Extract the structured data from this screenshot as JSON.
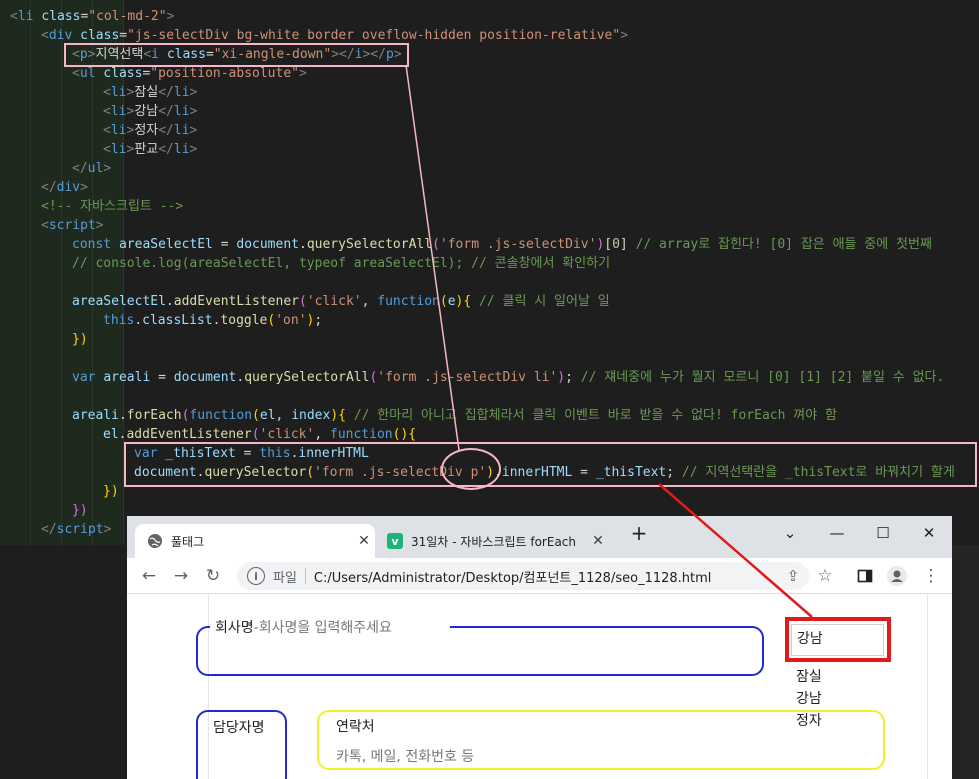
{
  "code": {
    "lines": [
      {
        "indent": 0,
        "tokens": [
          {
            "c": "c-punct",
            "t": "<"
          },
          {
            "c": "c-tag",
            "t": "li"
          },
          {
            "c": "c-plain",
            "t": " "
          },
          {
            "c": "c-attr",
            "t": "class"
          },
          {
            "c": "c-plain",
            "t": "="
          },
          {
            "c": "c-str",
            "t": "\"col-md-2\""
          },
          {
            "c": "c-punct",
            "t": ">"
          }
        ]
      },
      {
        "indent": 1,
        "tokens": [
          {
            "c": "c-punct",
            "t": "<"
          },
          {
            "c": "c-tag",
            "t": "div"
          },
          {
            "c": "c-plain",
            "t": " "
          },
          {
            "c": "c-attr",
            "t": "class"
          },
          {
            "c": "c-plain",
            "t": "="
          },
          {
            "c": "c-str",
            "t": "\"js-selectDiv bg-white border oveflow-hidden position-relative\""
          },
          {
            "c": "c-punct",
            "t": ">"
          }
        ]
      },
      {
        "indent": 2,
        "tokens": [
          {
            "c": "c-punct",
            "t": "<"
          },
          {
            "c": "c-tag",
            "t": "p"
          },
          {
            "c": "c-punct",
            "t": ">"
          },
          {
            "c": "c-text",
            "t": "지역선택"
          },
          {
            "c": "c-punct",
            "t": "<"
          },
          {
            "c": "c-tag",
            "t": "i"
          },
          {
            "c": "c-plain",
            "t": " "
          },
          {
            "c": "c-attr",
            "t": "class"
          },
          {
            "c": "c-plain",
            "t": "="
          },
          {
            "c": "c-str",
            "t": "\"xi-angle-down\""
          },
          {
            "c": "c-punct",
            "t": "></"
          },
          {
            "c": "c-tag",
            "t": "i"
          },
          {
            "c": "c-punct",
            "t": "></"
          },
          {
            "c": "c-tag",
            "t": "p"
          },
          {
            "c": "c-punct",
            "t": ">"
          }
        ]
      },
      {
        "indent": 2,
        "tokens": [
          {
            "c": "c-punct",
            "t": "<"
          },
          {
            "c": "c-tag",
            "t": "ul"
          },
          {
            "c": "c-plain",
            "t": " "
          },
          {
            "c": "c-attr",
            "t": "class"
          },
          {
            "c": "c-plain",
            "t": "="
          },
          {
            "c": "c-str",
            "t": "\"position-absolute\""
          },
          {
            "c": "c-punct",
            "t": ">"
          }
        ]
      },
      {
        "indent": 3,
        "tokens": [
          {
            "c": "c-punct",
            "t": "<"
          },
          {
            "c": "c-tag",
            "t": "li"
          },
          {
            "c": "c-punct",
            "t": ">"
          },
          {
            "c": "c-text",
            "t": "잠실"
          },
          {
            "c": "c-punct",
            "t": "</"
          },
          {
            "c": "c-tag",
            "t": "li"
          },
          {
            "c": "c-punct",
            "t": ">"
          }
        ]
      },
      {
        "indent": 3,
        "tokens": [
          {
            "c": "c-punct",
            "t": "<"
          },
          {
            "c": "c-tag",
            "t": "li"
          },
          {
            "c": "c-punct",
            "t": ">"
          },
          {
            "c": "c-text",
            "t": "강남"
          },
          {
            "c": "c-punct",
            "t": "</"
          },
          {
            "c": "c-tag",
            "t": "li"
          },
          {
            "c": "c-punct",
            "t": ">"
          }
        ]
      },
      {
        "indent": 3,
        "tokens": [
          {
            "c": "c-punct",
            "t": "<"
          },
          {
            "c": "c-tag",
            "t": "li"
          },
          {
            "c": "c-punct",
            "t": ">"
          },
          {
            "c": "c-text",
            "t": "정자"
          },
          {
            "c": "c-punct",
            "t": "</"
          },
          {
            "c": "c-tag",
            "t": "li"
          },
          {
            "c": "c-punct",
            "t": ">"
          }
        ]
      },
      {
        "indent": 3,
        "tokens": [
          {
            "c": "c-punct",
            "t": "<"
          },
          {
            "c": "c-tag",
            "t": "li"
          },
          {
            "c": "c-punct",
            "t": ">"
          },
          {
            "c": "c-text",
            "t": "판교"
          },
          {
            "c": "c-punct",
            "t": "</"
          },
          {
            "c": "c-tag",
            "t": "li"
          },
          {
            "c": "c-punct",
            "t": ">"
          }
        ]
      },
      {
        "indent": 2,
        "tokens": [
          {
            "c": "c-punct",
            "t": "</"
          },
          {
            "c": "c-tag",
            "t": "ul"
          },
          {
            "c": "c-punct",
            "t": ">"
          }
        ]
      },
      {
        "indent": 1,
        "tokens": [
          {
            "c": "c-punct",
            "t": "</"
          },
          {
            "c": "c-tag",
            "t": "div"
          },
          {
            "c": "c-punct",
            "t": ">"
          }
        ]
      },
      {
        "indent": 1,
        "tokens": [
          {
            "c": "c-cmt",
            "t": "<!-- 자바스크립트 -->"
          }
        ]
      },
      {
        "indent": 1,
        "tokens": [
          {
            "c": "c-punct",
            "t": "<"
          },
          {
            "c": "c-tag",
            "t": "script"
          },
          {
            "c": "c-punct",
            "t": ">"
          }
        ]
      },
      {
        "indent": 2,
        "tokens": [
          {
            "c": "c-kw",
            "t": "const"
          },
          {
            "c": "c-plain",
            "t": " "
          },
          {
            "c": "c-var",
            "t": "areaSelectEl"
          },
          {
            "c": "c-plain",
            "t": " = "
          },
          {
            "c": "c-var",
            "t": "document"
          },
          {
            "c": "c-plain",
            "t": "."
          },
          {
            "c": "c-fn",
            "t": "querySelectorAll"
          },
          {
            "c": "c-brace2",
            "t": "("
          },
          {
            "c": "c-str",
            "t": "'form .js-selectDiv'"
          },
          {
            "c": "c-brace2",
            "t": ")"
          },
          {
            "c": "c-plain",
            "t": "["
          },
          {
            "c": "c-num",
            "t": "0"
          },
          {
            "c": "c-plain",
            "t": "] "
          },
          {
            "c": "c-cmt",
            "t": "// array로 잡힌다! [0] 잡은 애들 중에 첫번째"
          }
        ]
      },
      {
        "indent": 2,
        "tokens": [
          {
            "c": "c-cmt",
            "t": "// console.log(areaSelectEl, typeof areaSelectEl); // 콘솔창에서 확인하기"
          }
        ]
      },
      {
        "indent": 0,
        "tokens": []
      },
      {
        "indent": 2,
        "tokens": [
          {
            "c": "c-var",
            "t": "areaSelectEl"
          },
          {
            "c": "c-plain",
            "t": "."
          },
          {
            "c": "c-fn",
            "t": "addEventListener"
          },
          {
            "c": "c-brace2",
            "t": "("
          },
          {
            "c": "c-str",
            "t": "'click'"
          },
          {
            "c": "c-plain",
            "t": ", "
          },
          {
            "c": "c-kw",
            "t": "function"
          },
          {
            "c": "c-brace",
            "t": "("
          },
          {
            "c": "c-var",
            "t": "e"
          },
          {
            "c": "c-brace",
            "t": ")"
          },
          {
            "c": "c-brace",
            "t": "{"
          },
          {
            "c": "c-plain",
            "t": " "
          },
          {
            "c": "c-cmt",
            "t": "// 클릭 시 일어날 일"
          }
        ]
      },
      {
        "indent": 3,
        "tokens": [
          {
            "c": "c-kw",
            "t": "this"
          },
          {
            "c": "c-plain",
            "t": "."
          },
          {
            "c": "c-var",
            "t": "classList"
          },
          {
            "c": "c-plain",
            "t": "."
          },
          {
            "c": "c-fn",
            "t": "toggle"
          },
          {
            "c": "c-brace",
            "t": "("
          },
          {
            "c": "c-str",
            "t": "'on'"
          },
          {
            "c": "c-brace",
            "t": ")"
          },
          {
            "c": "c-plain",
            "t": ";"
          }
        ]
      },
      {
        "indent": 2,
        "tokens": [
          {
            "c": "c-brace",
            "t": "})"
          }
        ]
      },
      {
        "indent": 0,
        "tokens": []
      },
      {
        "indent": 2,
        "tokens": [
          {
            "c": "c-kw",
            "t": "var"
          },
          {
            "c": "c-plain",
            "t": " "
          },
          {
            "c": "c-var",
            "t": "areali"
          },
          {
            "c": "c-plain",
            "t": " = "
          },
          {
            "c": "c-var",
            "t": "document"
          },
          {
            "c": "c-plain",
            "t": "."
          },
          {
            "c": "c-fn",
            "t": "querySelectorAll"
          },
          {
            "c": "c-brace2",
            "t": "("
          },
          {
            "c": "c-str",
            "t": "'form .js-selectDiv li'"
          },
          {
            "c": "c-brace2",
            "t": ")"
          },
          {
            "c": "c-plain",
            "t": "; "
          },
          {
            "c": "c-cmt",
            "t": "// 쟤네중에 누가 뭘지 모르니 [0] [1] [2] 붙일 수 없다."
          }
        ]
      },
      {
        "indent": 0,
        "tokens": []
      },
      {
        "indent": 2,
        "tokens": [
          {
            "c": "c-var",
            "t": "areali"
          },
          {
            "c": "c-plain",
            "t": "."
          },
          {
            "c": "c-fn",
            "t": "forEach"
          },
          {
            "c": "c-brace2",
            "t": "("
          },
          {
            "c": "c-kw",
            "t": "function"
          },
          {
            "c": "c-brace",
            "t": "("
          },
          {
            "c": "c-var",
            "t": "el"
          },
          {
            "c": "c-plain",
            "t": ", "
          },
          {
            "c": "c-var",
            "t": "index"
          },
          {
            "c": "c-brace",
            "t": ")"
          },
          {
            "c": "c-brace",
            "t": "{"
          },
          {
            "c": "c-plain",
            "t": " "
          },
          {
            "c": "c-cmt",
            "t": "// 한마리 아니고 집합체라서 클릭 이벤트 바로 받을 수 없다! forEach 껴야 함"
          }
        ]
      },
      {
        "indent": 3,
        "tokens": [
          {
            "c": "c-var",
            "t": "el"
          },
          {
            "c": "c-plain",
            "t": "."
          },
          {
            "c": "c-fn",
            "t": "addEventListener"
          },
          {
            "c": "c-brace2",
            "t": "("
          },
          {
            "c": "c-str",
            "t": "'click'"
          },
          {
            "c": "c-plain",
            "t": ", "
          },
          {
            "c": "c-kw",
            "t": "function"
          },
          {
            "c": "c-brace",
            "t": "()"
          },
          {
            "c": "c-brace",
            "t": "{"
          }
        ]
      },
      {
        "indent": 4,
        "tokens": [
          {
            "c": "c-kw",
            "t": "var"
          },
          {
            "c": "c-plain",
            "t": " "
          },
          {
            "c": "c-var",
            "t": "_thisText"
          },
          {
            "c": "c-plain",
            "t": " = "
          },
          {
            "c": "c-kw",
            "t": "this"
          },
          {
            "c": "c-plain",
            "t": "."
          },
          {
            "c": "c-var",
            "t": "innerHTML"
          }
        ]
      },
      {
        "indent": 4,
        "tokens": [
          {
            "c": "c-var",
            "t": "document"
          },
          {
            "c": "c-plain",
            "t": "."
          },
          {
            "c": "c-fn",
            "t": "querySelector"
          },
          {
            "c": "c-brace",
            "t": "("
          },
          {
            "c": "c-str",
            "t": "'form .js-selectDiv p'"
          },
          {
            "c": "c-brace",
            "t": ")"
          },
          {
            "c": "c-plain",
            "t": "."
          },
          {
            "c": "c-var",
            "t": "innerHTML"
          },
          {
            "c": "c-plain",
            "t": " = "
          },
          {
            "c": "c-var",
            "t": "_thisText"
          },
          {
            "c": "c-plain",
            "t": "; "
          },
          {
            "c": "c-cmt",
            "t": "// 지역선택란을 _thisText로 바꿔치기 할게"
          }
        ]
      },
      {
        "indent": 3,
        "tokens": [
          {
            "c": "c-brace",
            "t": "})"
          }
        ]
      },
      {
        "indent": 2,
        "tokens": [
          {
            "c": "c-brace2",
            "t": "})"
          }
        ]
      },
      {
        "indent": 1,
        "tokens": [
          {
            "c": "c-punct",
            "t": "</"
          },
          {
            "c": "c-tag",
            "t": "script"
          },
          {
            "c": "c-punct",
            "t": ">"
          }
        ]
      }
    ]
  },
  "browser": {
    "tabs": [
      {
        "title": "풀태그",
        "favicon": "globe-icon",
        "active": true
      },
      {
        "title": "31일차 - 자바스크립트 forEach",
        "favicon": "v-logo-icon",
        "active": false
      }
    ],
    "new_tab_label": "+",
    "window_controls": {
      "chevron": "⌄",
      "minimize": "—",
      "maximize": "☐",
      "close": "✕"
    },
    "address": {
      "protocol_label": "파일",
      "url": "C:/Users/Administrator/Desktop/컴포넌트_1128/seo_1128.html"
    },
    "colors": {
      "accent_red": "#e01b1b",
      "highlight_pink": "#f7b6c4",
      "field_blue": "#1f2ad6",
      "field_yellow": "#f3ef2a"
    }
  },
  "form": {
    "company": {
      "legend": "회사명",
      "placeholder": "-회사명을 입력해주세요"
    },
    "manager": {
      "legend": "담당자명"
    },
    "contact": {
      "legend": "연락처",
      "placeholder": "카톡, 메일, 전화번호 등"
    },
    "area_select": {
      "selected": "강남",
      "options": [
        "잠실",
        "강남",
        "정자"
      ]
    }
  }
}
